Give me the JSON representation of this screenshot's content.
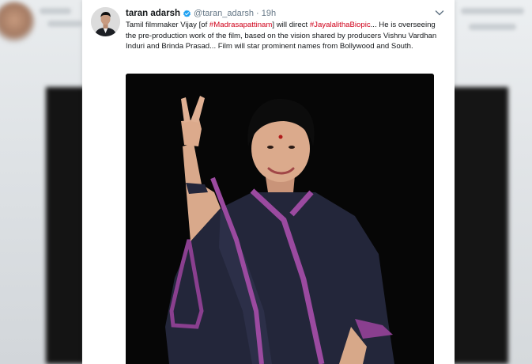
{
  "tweet": {
    "author_name": "taran adarsh",
    "handle": "@taran_adarsh",
    "separator": "·",
    "time": "19h",
    "text_before_1": "Tamil filmmaker Vijay [of ",
    "hashtag_1": "#Madrasapattinam",
    "text_between": "] will direct ",
    "hashtag_2": "#JayalalithaBiopic",
    "text_after": "... He is overseeing the pre-production work of the film, based on the vision shared by producers Vishnu Vardhan Induri and Brinda Prasad... Film will star prominent names from Bollywood and South.",
    "icons": {
      "verified": "verified-badge-icon",
      "menu": "chevron-down-icon"
    },
    "colors": {
      "hashtag": "#d0021b",
      "verified": "#1da1f2",
      "muted": "#657786"
    }
  }
}
